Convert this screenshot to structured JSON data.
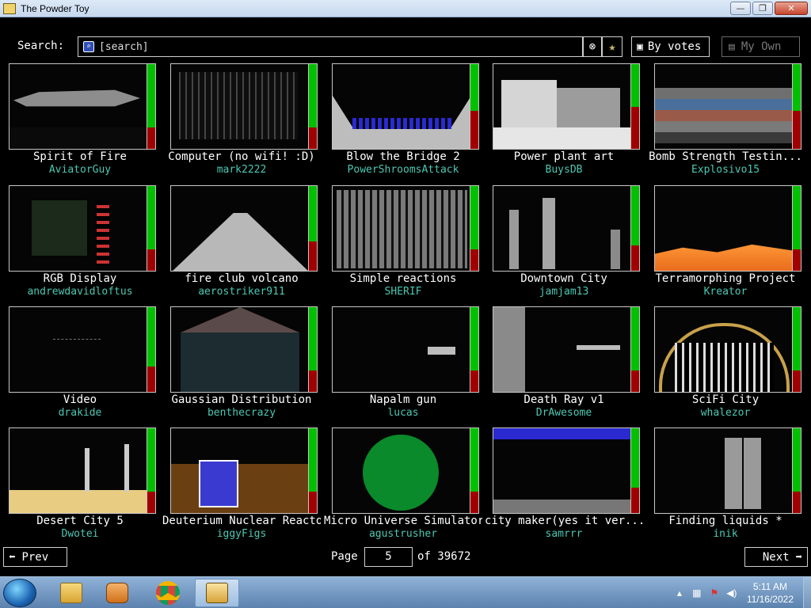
{
  "window": {
    "title": "The Powder Toy",
    "buttons": {
      "minimize": "—",
      "maximize": "❐",
      "close": "✕"
    }
  },
  "search": {
    "label": "Search:",
    "placeholder": "[search]",
    "clear_icon": "clear-icon",
    "favorite_icon": "star-icon",
    "sort_label": "By votes",
    "own_label": "My Own"
  },
  "saves": [
    {
      "name": "Spirit of Fire",
      "author": "AviatorGuy",
      "upvote_fraction": 0.75,
      "art": "ship"
    },
    {
      "name": "Computer (no wifi! :D)",
      "author": "mark2222",
      "upvote_fraction": 0.75,
      "art": "circuit"
    },
    {
      "name": "Blow the Bridge 2",
      "author": "PowerShroomsAttack",
      "upvote_fraction": 0.55,
      "art": "bridge"
    },
    {
      "name": "Power plant art",
      "author": "BuysDB",
      "upvote_fraction": 0.5,
      "art": "plant"
    },
    {
      "name": "Bomb Strength Testin...",
      "author": "Explosivo15",
      "upvote_fraction": 0.55,
      "art": "bands"
    },
    {
      "name": "RGB Display",
      "author": "andrewdavidloftus",
      "upvote_fraction": 0.75,
      "art": "display"
    },
    {
      "name": "fire club volcano",
      "author": "aerostriker911",
      "upvote_fraction": 0.65,
      "art": "volcano"
    },
    {
      "name": "Simple reactions",
      "author": "SHERIF",
      "upvote_fraction": 0.75,
      "art": "reactions"
    },
    {
      "name": "Downtown City",
      "author": "jamjam13",
      "upvote_fraction": 0.7,
      "art": "city"
    },
    {
      "name": "Terramorphing Project",
      "author": "Kreator",
      "upvote_fraction": 0.75,
      "art": "terra"
    },
    {
      "name": "Video",
      "author": "drakide",
      "upvote_fraction": 0.7,
      "art": "video"
    },
    {
      "name": "Gaussian Distribution",
      "author": "benthecrazy",
      "upvote_fraction": 0.75,
      "art": "gauss"
    },
    {
      "name": "Napalm gun",
      "author": "lucas",
      "upvote_fraction": 0.75,
      "art": "gun"
    },
    {
      "name": "Death Ray v1",
      "author": "DrAwesome",
      "upvote_fraction": 0.75,
      "art": "deathray"
    },
    {
      "name": "SciFi City",
      "author": "whalezor",
      "upvote_fraction": 0.75,
      "art": "dome"
    },
    {
      "name": "Desert City 5",
      "author": "Dwotei",
      "upvote_fraction": 0.75,
      "art": "desert"
    },
    {
      "name": "Deuterium Nuclear Reactor",
      "author": "iggyFigs",
      "upvote_fraction": 0.75,
      "art": "reactor"
    },
    {
      "name": "Micro Universe Simulator",
      "author": "agustrusher",
      "upvote_fraction": 0.75,
      "art": "universe"
    },
    {
      "name": "city maker(yes it ver...",
      "author": "samrrr",
      "upvote_fraction": 0.7,
      "art": "maker"
    },
    {
      "name": "Finding liquids *",
      "author": "inik",
      "upvote_fraction": 0.75,
      "art": "liquids"
    }
  ],
  "pagination": {
    "prev_label": "Prev",
    "next_label": "Next",
    "page_label": "Page",
    "page_value": "5",
    "of_label": "of 39672"
  },
  "taskbar": {
    "apps": [
      "file-explorer-icon",
      "media-player-icon",
      "chrome-icon",
      "powder-toy-icon"
    ],
    "time": "5:11 AM",
    "date": "11/16/2022"
  }
}
